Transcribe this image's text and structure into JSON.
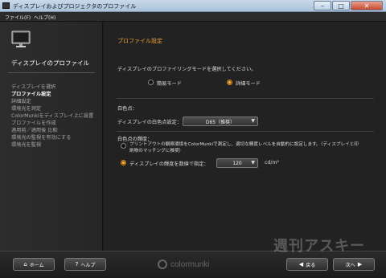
{
  "window": {
    "title": "ディスプレイおよびプロジェクタのプロファイル",
    "controls": [
      "–",
      "□",
      "✕"
    ]
  },
  "menu": [
    {
      "label": "ファイル(F)"
    },
    {
      "label": "ヘルプ(H)"
    }
  ],
  "sidebar": {
    "heading": "ディスプレイのプロファイル",
    "steps": [
      {
        "label": "ディスプレイを選択",
        "active": false
      },
      {
        "label": "プロファイル設定",
        "active": true
      },
      {
        "label": "詳細設定",
        "active": false
      },
      {
        "label": "環境光を測定",
        "active": false
      },
      {
        "label": "ColorMunkiをディスプレイ上に設置",
        "active": false
      },
      {
        "label": "プロファイルを作成",
        "active": false
      },
      {
        "label": "適用前／適用後 比較",
        "active": false
      },
      {
        "label": "環境光の監視を有効にする",
        "active": false
      },
      {
        "label": "環境光を監視",
        "active": false
      }
    ]
  },
  "main": {
    "section_title": "プロファイル設定",
    "instruction": "ディスプレイのプロファイリングモードを選択してください。",
    "mode_options": [
      {
        "label": "簡易モード",
        "selected": false
      },
      {
        "label": "詳細モード",
        "selected": true
      }
    ],
    "whitepoint": {
      "heading": "白色点：",
      "field_label": "ディスプレイの白色点設定：",
      "value": "D65（推奨）"
    },
    "luminance": {
      "heading": "白色点の輝度：",
      "option1": "プリントアウトの観察環境をColorMunkiで測定し、適切な輝度レベルを自動的に設定します。（ディスプレイと印刷物のマッチングに推奨）",
      "option1_selected": false,
      "option2": "ディスプレイの輝度を数値で指定：",
      "option2_selected": true,
      "value": "120",
      "unit": "cd/m²"
    }
  },
  "footer": {
    "home_label": "ホーム",
    "help_label": "ヘルプ",
    "back_label": "戻る",
    "next_label": "次へ",
    "brand": "colormunki",
    "watermark": "週刊アスキー"
  },
  "colors": {
    "accent": "#f0a030",
    "background": "#222222",
    "sidebar": "#2b2b2b"
  },
  "icons": [
    "app-icon",
    "monitor-icon",
    "home-icon",
    "help-icon",
    "back-arrow-icon",
    "next-arrow-icon",
    "dropdown-arrow-icon"
  ]
}
